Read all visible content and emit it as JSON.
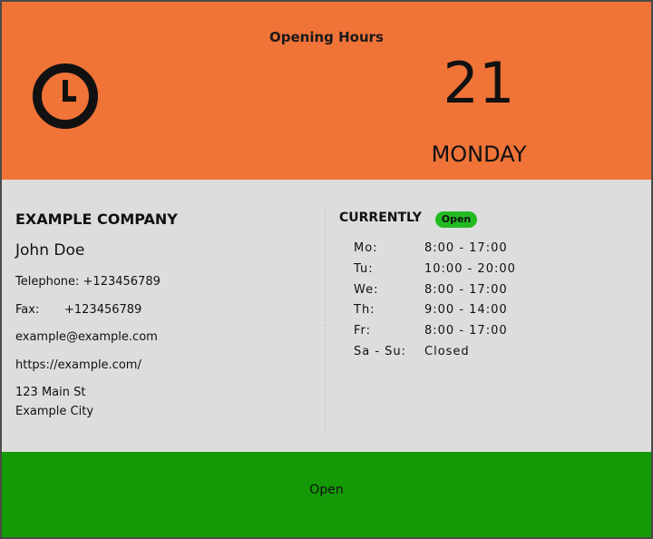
{
  "header": {
    "title": "Opening Hours",
    "day_number": "21",
    "day_name": "MONDAY",
    "icon": "clock-icon",
    "background": "#f07338"
  },
  "company": {
    "name": "EXAMPLE COMPANY",
    "contact_person": "John Doe",
    "telephone": "Telephone: +123456789",
    "fax_label": "Fax:",
    "fax_value": "+123456789",
    "email": "example@example.com",
    "website": "https://example.com/",
    "address_line1": "123 Main St",
    "address_line2": "Example City"
  },
  "status": {
    "currently_label": "CURRENTLY",
    "badge": "Open",
    "badge_color": "#22bb22"
  },
  "hours": [
    {
      "day": "Mo:",
      "time": "8:00 - 17:00"
    },
    {
      "day": "Tu:",
      "time": "10:00 - 20:00"
    },
    {
      "day": "We:",
      "time": "8:00 - 17:00"
    },
    {
      "day": "Th:",
      "time": "9:00 - 14:00"
    },
    {
      "day": "Fr:",
      "time": "8:00 - 17:00"
    },
    {
      "day": "Sa - Su:",
      "time": "Closed"
    }
  ],
  "footer": {
    "status_text": "Open",
    "background": "#149a06"
  }
}
